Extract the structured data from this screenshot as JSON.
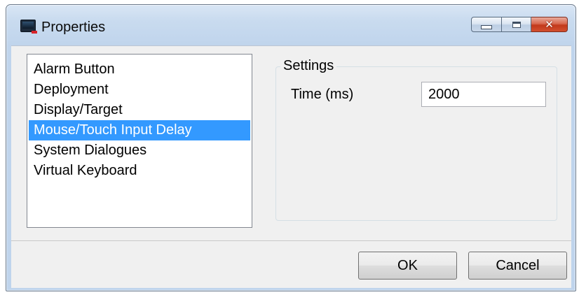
{
  "window": {
    "title": "Properties",
    "icon": "monitor-app-icon",
    "caption_buttons": [
      "minimize-icon",
      "maximize-icon",
      "close-icon"
    ],
    "close_glyph": "✕"
  },
  "categories": {
    "items": [
      {
        "label": "Alarm Button",
        "selected": false
      },
      {
        "label": "Deployment",
        "selected": false
      },
      {
        "label": "Display/Target",
        "selected": false
      },
      {
        "label": "Mouse/Touch Input Delay",
        "selected": true
      },
      {
        "label": "System Dialogues",
        "selected": false
      },
      {
        "label": "Virtual Keyboard",
        "selected": false
      }
    ],
    "selection_color": "#3399ff"
  },
  "settings": {
    "group_label": "Settings",
    "time_label": "Time (ms)",
    "time_value": "2000"
  },
  "footer": {
    "ok_label": "OK",
    "cancel_label": "Cancel"
  }
}
